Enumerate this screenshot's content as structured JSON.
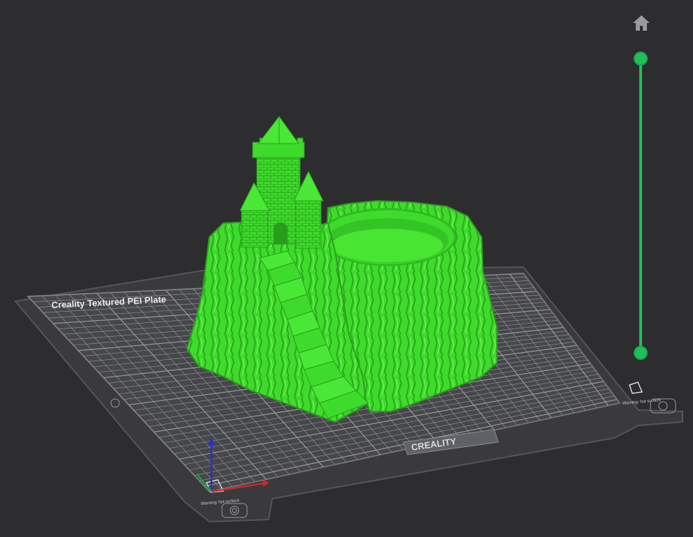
{
  "scene": {
    "background_color": "#2d2d2f",
    "model_color": "#3fdb2c",
    "plate": {
      "label": "Creality Textured PEI Plate",
      "brand": "CREALITY",
      "warning_text": "Warning: hot surface",
      "plate_color": "#3a3a3c",
      "grid_color": "#9a9a9a"
    },
    "axes": {
      "x_color": "#d32626",
      "y_color": "#1aa34a",
      "z_color": "#2b2ed1"
    }
  },
  "controls": {
    "home_icon": "home-icon",
    "layer_slider": {
      "color": "#1fc05c",
      "upper_value": 1.0,
      "lower_value": 0.0
    }
  }
}
